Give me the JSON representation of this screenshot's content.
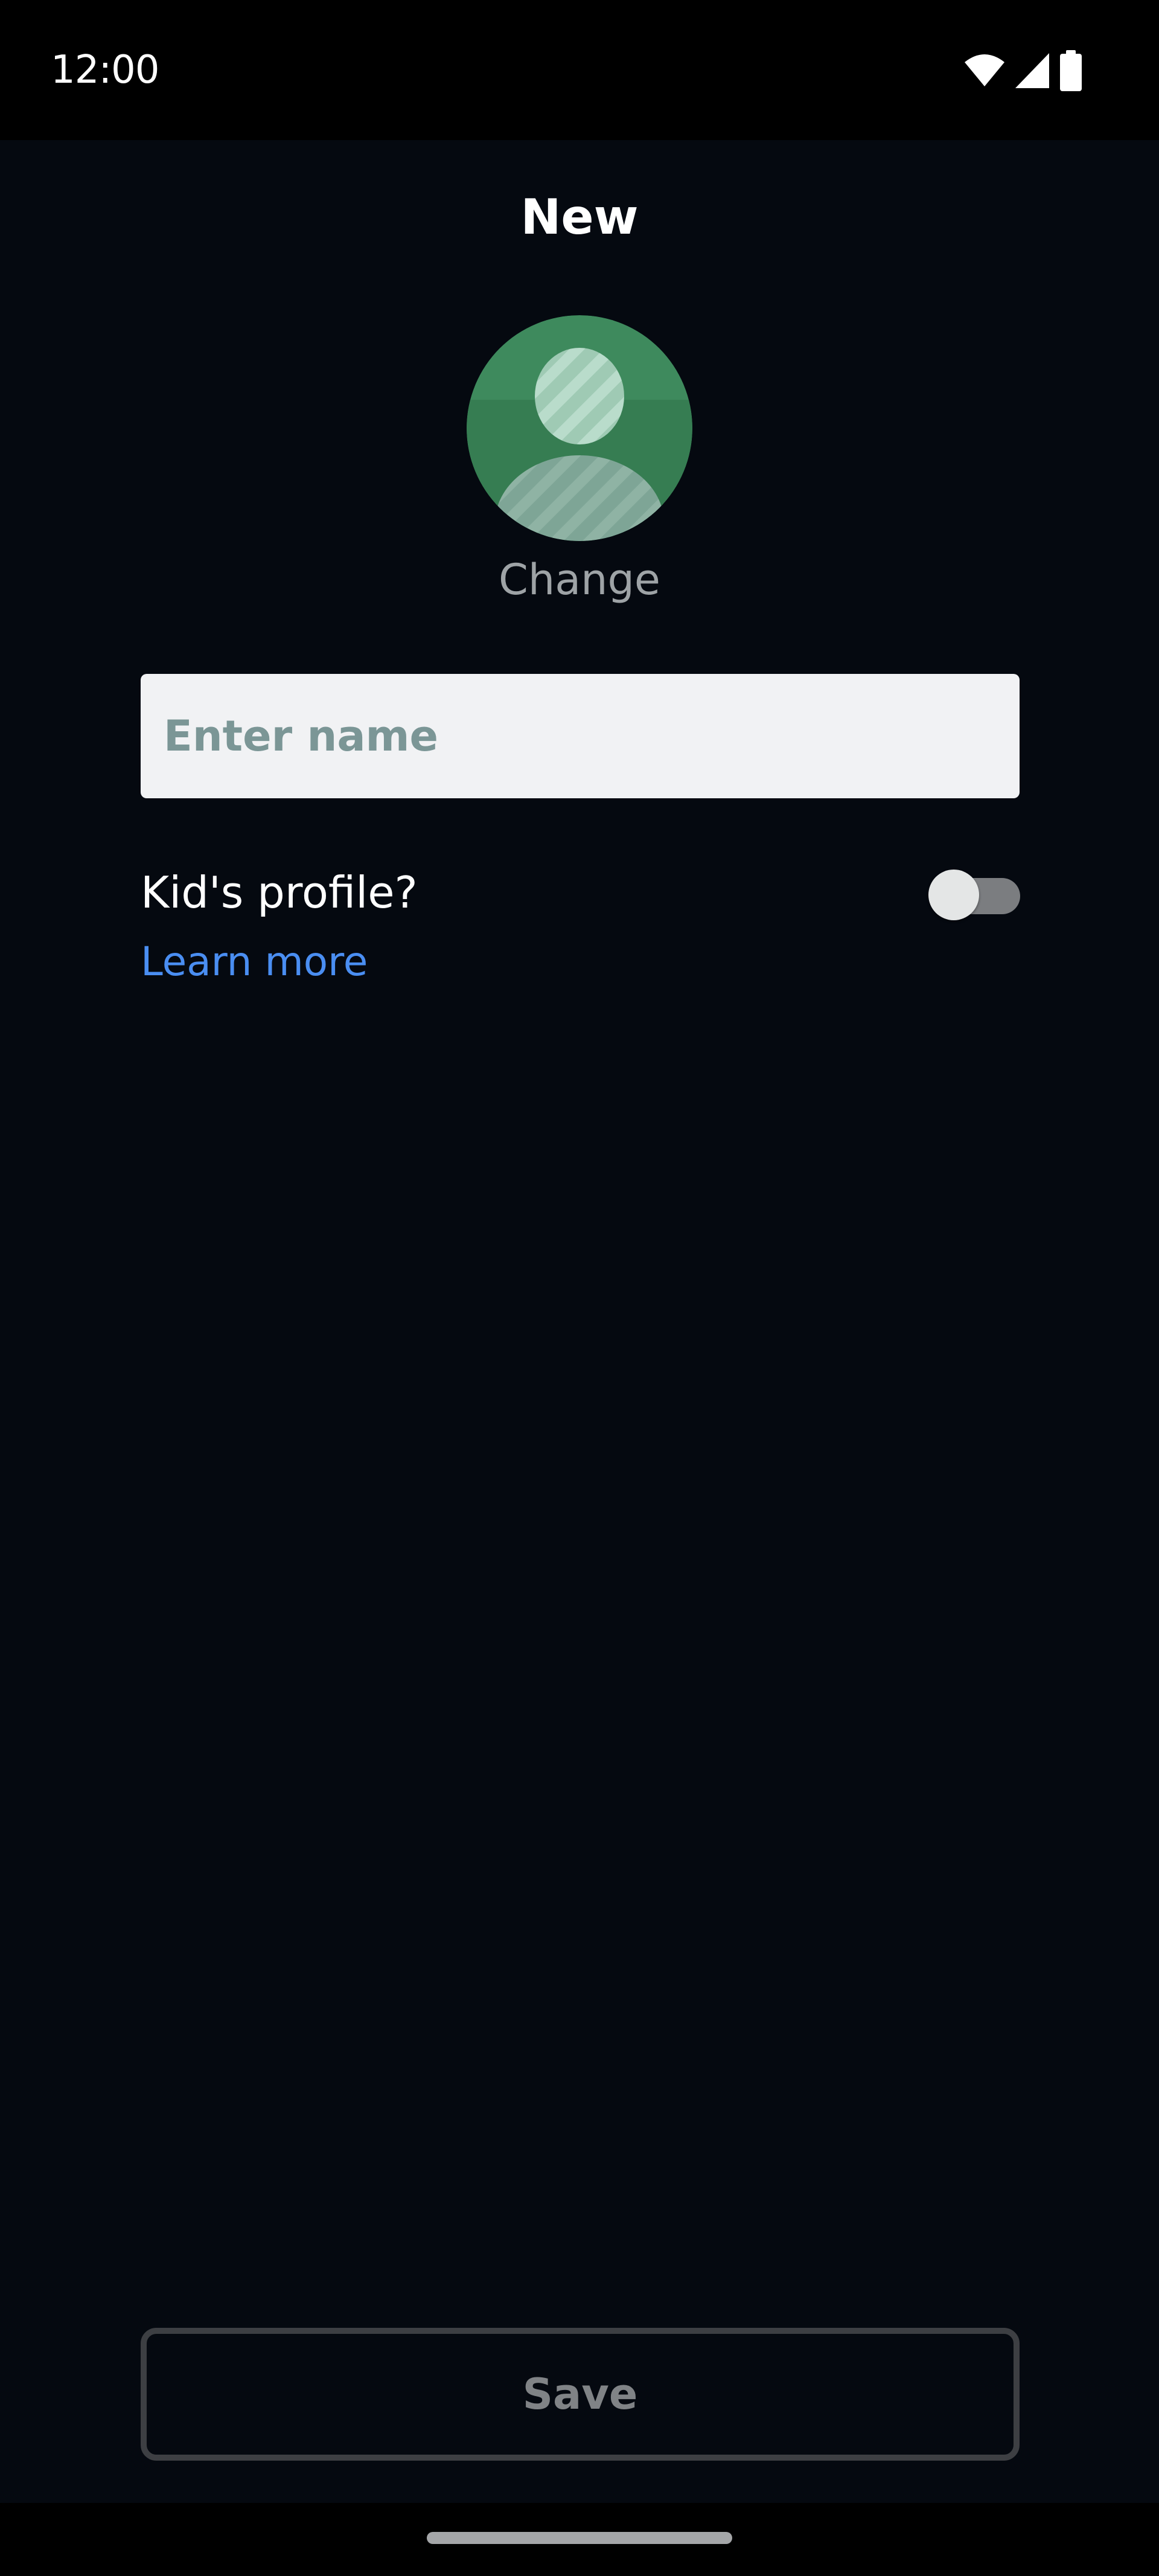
{
  "status_bar": {
    "time": "12:00",
    "icons": [
      "wifi-icon",
      "cellular-signal-icon",
      "battery-icon"
    ]
  },
  "page": {
    "title": "New"
  },
  "avatar": {
    "icon": "person-avatar-icon",
    "background_color": "#3e8a5d",
    "change_label": "Change"
  },
  "name_input": {
    "placeholder": "Enter name",
    "value": ""
  },
  "kids_profile": {
    "label": "Kid's profile?",
    "toggle_on": false,
    "learn_more_label": "Learn more"
  },
  "footer": {
    "save_label": "Save"
  },
  "colors": {
    "background": "#050910",
    "link": "#4a8ef2",
    "input_background": "#f1f2f4",
    "disabled_button_border": "#3d3f43"
  }
}
